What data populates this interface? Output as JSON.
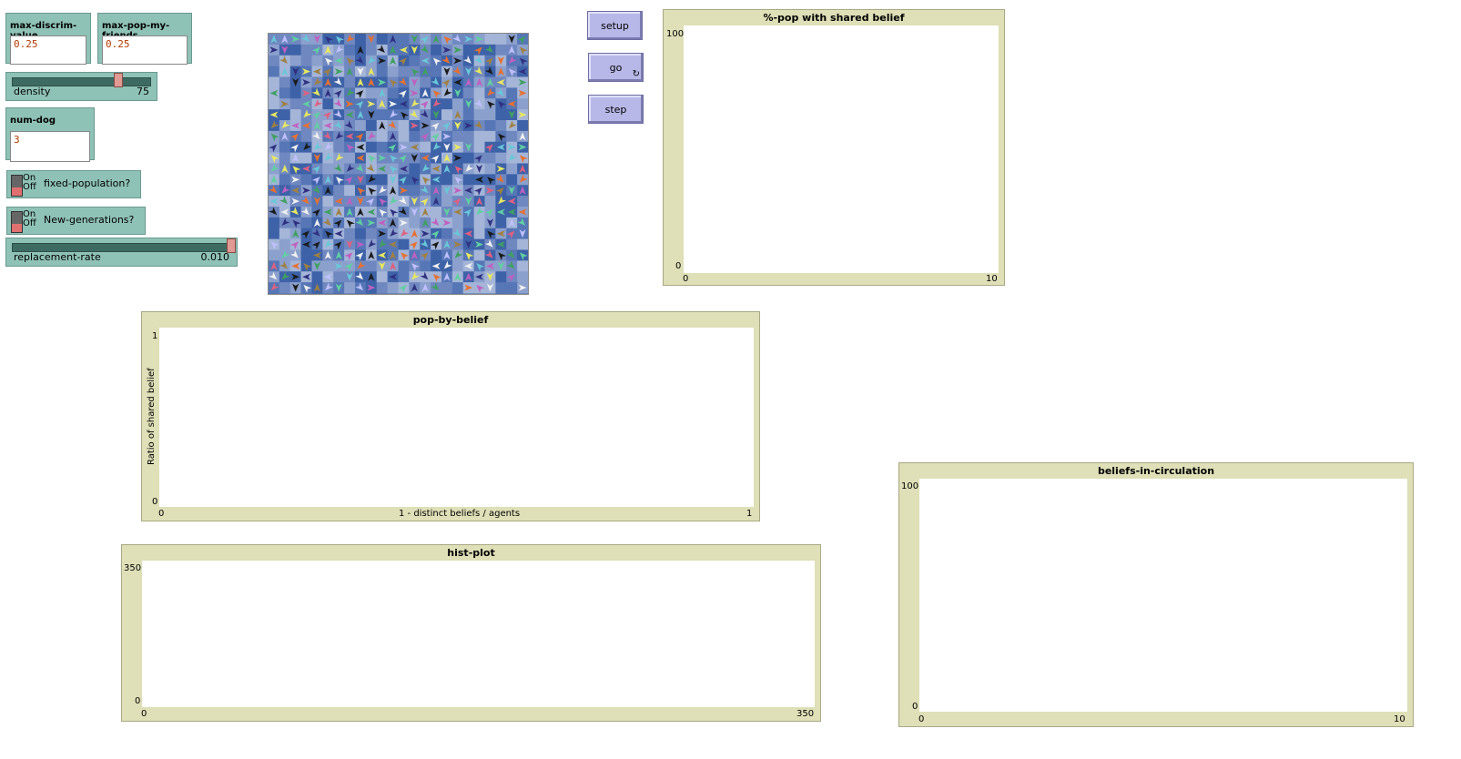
{
  "inputs": {
    "max_discrim": {
      "label": "max-discrim-value",
      "value": "0.25"
    },
    "max_pop": {
      "label": "max-pop-my-friends",
      "value": "0.25"
    },
    "num_dog": {
      "label": "num-dog",
      "value": "3"
    }
  },
  "sliders": {
    "density": {
      "label": "density",
      "value": "75",
      "fraction": 0.75
    },
    "replacement": {
      "label": "replacement-rate",
      "value": "0.010",
      "fraction": 1.0
    }
  },
  "switches": {
    "fixed_population": {
      "label": "fixed-population?",
      "on": "On",
      "off": "Off"
    },
    "new_generations": {
      "label": "New-generations?",
      "on": "On",
      "off": "Off"
    }
  },
  "buttons": {
    "setup": "setup",
    "go": "go",
    "go_icon": "↻",
    "step": "step"
  },
  "plots": {
    "pop_shared": {
      "title": "%-pop with shared belief",
      "ymax": "100",
      "ymin": "0",
      "xmin": "0",
      "xmax": "10"
    },
    "pop_by_belief": {
      "title": "pop-by-belief",
      "ymax": "1",
      "ymin": "0",
      "xmin": "0",
      "xmax": "1",
      "xlabel": "1 - distinct beliefs / agents",
      "ylabel": "Ratio of shared belief"
    },
    "hist_plot": {
      "title": "hist-plot",
      "ymax": "350",
      "ymin": "0",
      "xmin": "0",
      "xmax": "350"
    },
    "beliefs_circ": {
      "title": "beliefs-in-circulation",
      "ymax": "100",
      "ymin": "0",
      "xmin": "0",
      "xmax": "10"
    }
  },
  "colors": {
    "patch_shades": [
      "#3e62a8",
      "#5676b6",
      "#7088c0",
      "#8ba0cc",
      "#a4b5d8"
    ],
    "agent_colors": [
      "#1a1a1a",
      "#e8e860",
      "#68c8d8",
      "#e87030",
      "#40a060",
      "#c060c0",
      "#f0f0f0",
      "#e06080",
      "#a08040",
      "#60d0a0",
      "#c0c0ff",
      "#303080"
    ]
  }
}
